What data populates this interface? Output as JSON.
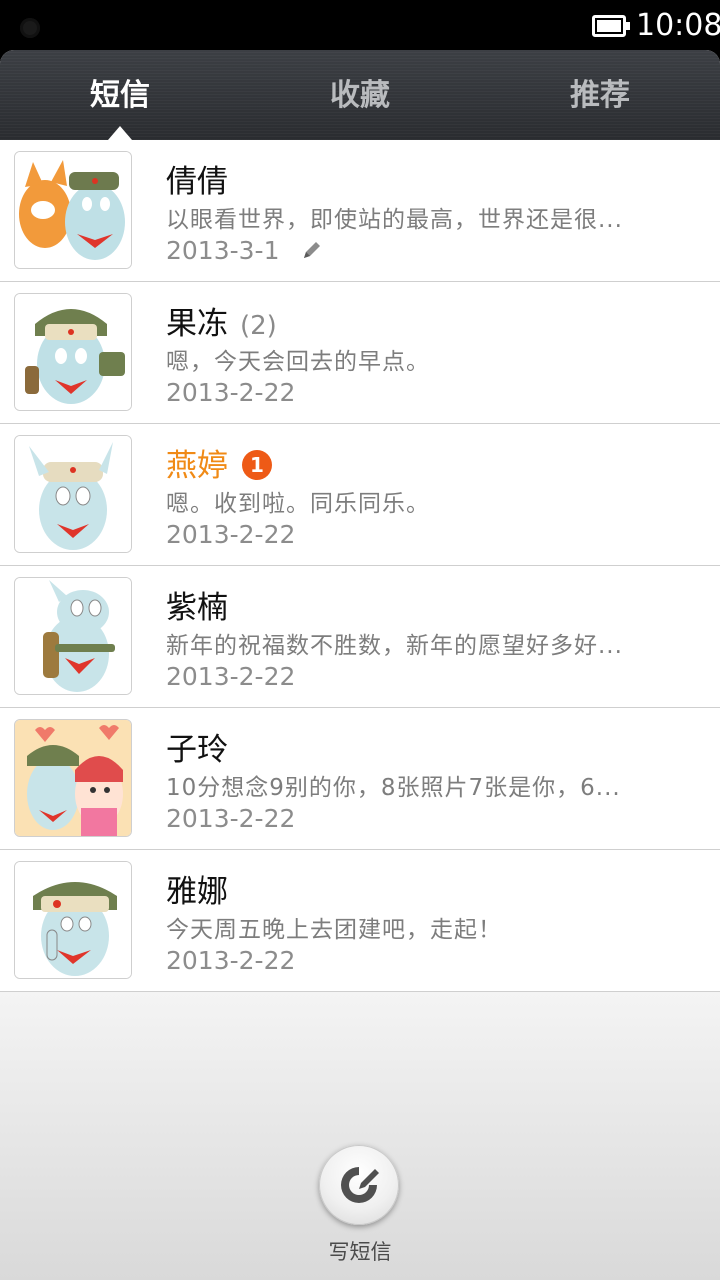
{
  "status": {
    "time": "10:08"
  },
  "tabs": [
    {
      "label": "短信",
      "active": true
    },
    {
      "label": "收藏",
      "active": false
    },
    {
      "label": "推荐",
      "active": false
    }
  ],
  "threads": [
    {
      "name": "倩倩",
      "count": "",
      "badge": "",
      "preview": "以眼看世界，即使站的最高，世界还是很...",
      "date": "2013-3-1",
      "draft": true
    },
    {
      "name": "果冻",
      "count": "(2)",
      "badge": "",
      "preview": "嗯，今天会回去的早点。",
      "date": "2013-2-22",
      "draft": false
    },
    {
      "name": "燕婷",
      "count": "",
      "badge": "1",
      "preview": "嗯。收到啦。同乐同乐。",
      "date": "2013-2-22",
      "draft": false
    },
    {
      "name": "紫楠",
      "count": "",
      "badge": "",
      "preview": "新年的祝福数不胜数，新年的愿望好多好...",
      "date": "2013-2-22",
      "draft": false
    },
    {
      "name": "子玲",
      "count": "",
      "badge": "",
      "preview": "10分想念9别的你，8张照片7张是你，6...",
      "date": "2013-2-22",
      "draft": false
    },
    {
      "name": "雅娜",
      "count": "",
      "badge": "",
      "preview": "今天周五晚上去团建吧，走起！",
      "date": "2013-2-22",
      "draft": false
    }
  ],
  "compose": {
    "label": "写短信"
  },
  "colors": {
    "accent": "#f08a16",
    "badge": "#ee5a16",
    "tabbar": "#2f3236"
  }
}
